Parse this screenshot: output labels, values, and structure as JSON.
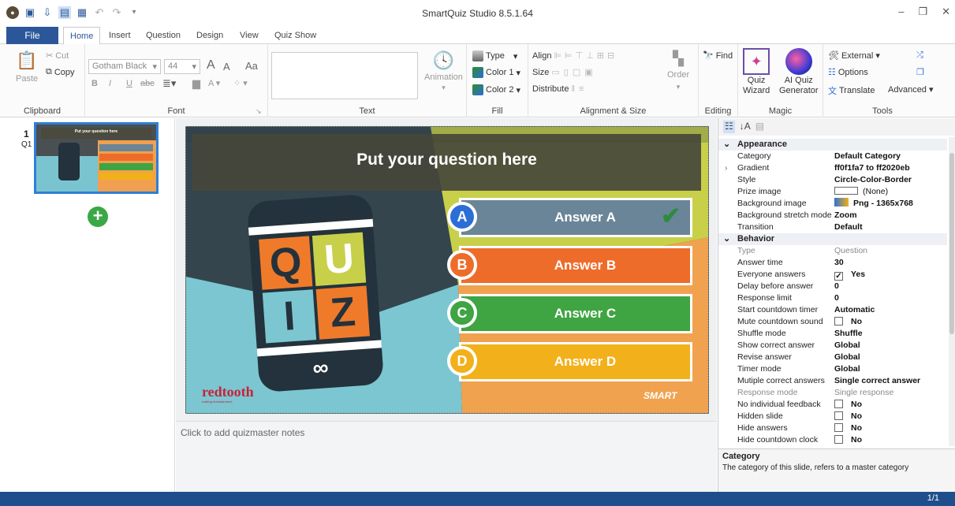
{
  "window": {
    "title": "SmartQuiz Studio 8.5.1.64"
  },
  "menu": {
    "file": "File",
    "tabs": [
      "Home",
      "Insert",
      "Question",
      "Design",
      "View",
      "Quiz Show"
    ]
  },
  "ribbon": {
    "clipboard": {
      "label": "Clipboard",
      "paste": "Paste",
      "cut": "Cut",
      "copy": "Copy"
    },
    "font": {
      "label": "Font",
      "family": "Gotham Black",
      "size": "44",
      "grow": "A",
      "shrink": "A",
      "case": "Aa",
      "bold": "B",
      "italic": "I",
      "underline": "U",
      "strike": "abc"
    },
    "text": {
      "label": "Text",
      "animation": "Animation"
    },
    "fill": {
      "label": "Fill",
      "type": "Type",
      "color1": "Color 1",
      "color2": "Color 2"
    },
    "align": {
      "label": "Alignment & Size",
      "align": "Align",
      "size": "Size",
      "distribute": "Distribute",
      "order": "Order"
    },
    "editing": {
      "label": "Editing",
      "find": "Find"
    },
    "magic": {
      "label": "Magic",
      "wizard_line1": "Quiz",
      "wizard_line2": "Wizard",
      "ai_line1": "AI Quiz",
      "ai_line2": "Generator"
    },
    "tools": {
      "label": "Tools",
      "external": "External",
      "options": "Options",
      "translate": "Translate",
      "advanced": "Advanced"
    }
  },
  "slides_panel": {
    "number": "1",
    "id": "Q1",
    "thumb_title": "Put your question here"
  },
  "slide": {
    "question": "Put your question here",
    "answers": [
      {
        "letter": "A",
        "text": "Answer A",
        "color": "#6a8598",
        "correct": true
      },
      {
        "letter": "B",
        "text": "Answer B",
        "color": "#ee6c2a",
        "correct": false
      },
      {
        "letter": "C",
        "text": "Answer C",
        "color": "#3fa442",
        "correct": false
      },
      {
        "letter": "D",
        "text": "Answer D",
        "color": "#f2b01a",
        "correct": false
      }
    ],
    "quiz_letters": [
      "Q",
      "U",
      "I",
      "Z"
    ],
    "brand": "redtooth",
    "brand_sub": "making entertainment",
    "smart_logo": "SMART"
  },
  "notes": {
    "placeholder": "Click to add quizmaster notes"
  },
  "properties": {
    "appearance_label": "Appearance",
    "appearance": [
      {
        "name": "Category",
        "value": "Default Category"
      },
      {
        "name": "Gradient",
        "value": "ff0f1fa7 to ff2020eb"
      },
      {
        "name": "Style",
        "value": "Circle-Color-Border"
      },
      {
        "name": "Prize image",
        "value": "(None)"
      },
      {
        "name": "Background image",
        "value": "Png - 1365x768"
      },
      {
        "name": "Background stretch mode",
        "value": "Zoom"
      },
      {
        "name": "Transition",
        "value": "Default"
      }
    ],
    "behavior_label": "Behavior",
    "behavior": [
      {
        "name": "Type",
        "value": "Question"
      },
      {
        "name": "Answer time",
        "value": "30"
      },
      {
        "name": "Everyone answers",
        "value": "Yes"
      },
      {
        "name": "Delay before answer",
        "value": "0"
      },
      {
        "name": "Response limit",
        "value": "0"
      },
      {
        "name": "Start countdown timer",
        "value": "Automatic"
      },
      {
        "name": "Mute countdown sound",
        "value": "No"
      },
      {
        "name": "Shuffle mode",
        "value": "Shuffle"
      },
      {
        "name": "Show correct answer",
        "value": "Global"
      },
      {
        "name": "Revise answer",
        "value": "Global"
      },
      {
        "name": "Timer mode",
        "value": "Global"
      },
      {
        "name": "Mutiple correct answers",
        "value": "Single correct answer"
      },
      {
        "name": "Response mode",
        "value": "Single response"
      },
      {
        "name": "No individual feedback",
        "value": "No"
      },
      {
        "name": "Hidden slide",
        "value": "No"
      },
      {
        "name": "Hide answers",
        "value": "No"
      },
      {
        "name": "Hide countdown clock",
        "value": "No"
      }
    ],
    "desc_title": "Category",
    "desc_text": "The category of this slide, refers to a master category"
  },
  "status": {
    "page": "1/1"
  }
}
